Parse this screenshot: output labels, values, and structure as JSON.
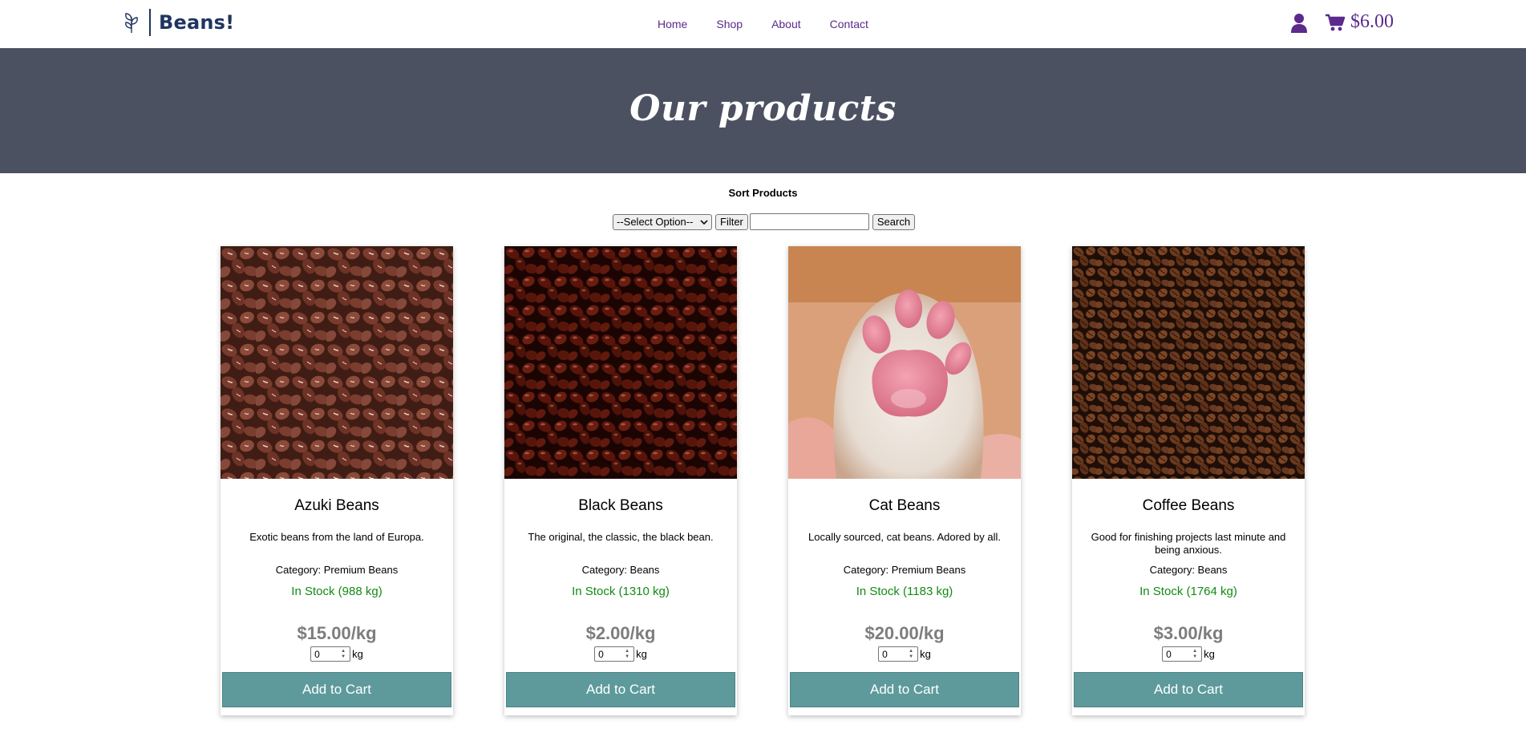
{
  "brand": {
    "name": "Beans!",
    "logo_icon": "bean-sprout-logo-icon"
  },
  "nav": {
    "items": [
      {
        "label": "Home"
      },
      {
        "label": "Shop"
      },
      {
        "label": "About"
      },
      {
        "label": "Contact"
      }
    ]
  },
  "header": {
    "user_icon": "user-icon",
    "cart_icon": "shopping-cart-icon",
    "cart_total": "$6.00"
  },
  "hero": {
    "title": "Our products",
    "background": "#4b5161"
  },
  "sort": {
    "title": "Sort Products",
    "select_value": "--Select Option--",
    "filter_label": "Filter",
    "search_value": "",
    "search_label": "Search"
  },
  "colors": {
    "accent": "#5b2a8c",
    "stock": "#138a13",
    "button": "#5e9a9c",
    "price": "#7d7d7d"
  },
  "products": [
    {
      "name": "Azuki Beans",
      "description": "Exotic beans from the land of Europa.",
      "category": "Category: Premium Beans",
      "stock": "In Stock (988 kg)",
      "price": "$15.00/kg",
      "qty": "0",
      "unit": "kg",
      "button": "Add to Cart",
      "image": "azuki-beans-photo"
    },
    {
      "name": "Black Beans",
      "description": "The original, the classic, the black bean.",
      "category": "Category: Beans",
      "stock": "In Stock (1310 kg)",
      "price": "$2.00/kg",
      "qty": "0",
      "unit": "kg",
      "button": "Add to Cart",
      "image": "black-beans-photo"
    },
    {
      "name": "Cat Beans",
      "description": "Locally sourced, cat beans. Adored by all.",
      "category": "Category: Premium Beans",
      "stock": "In Stock (1183 kg)",
      "price": "$20.00/kg",
      "qty": "0",
      "unit": "kg",
      "button": "Add to Cart",
      "image": "cat-paw-photo"
    },
    {
      "name": "Coffee Beans",
      "description": "Good for finishing projects last minute and being anxious.",
      "category": "Category: Beans",
      "stock": "In Stock (1764 kg)",
      "price": "$3.00/kg",
      "qty": "0",
      "unit": "kg",
      "button": "Add to Cart",
      "image": "coffee-beans-photo"
    }
  ]
}
